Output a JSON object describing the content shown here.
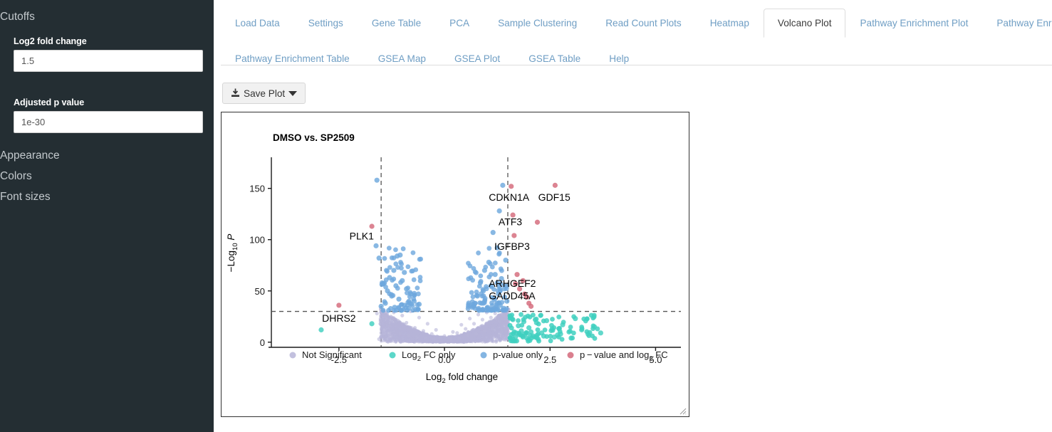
{
  "sidebar": {
    "cutoffs_heading": "Cutoffs",
    "fields": [
      {
        "label": "Log2 fold change",
        "value": "1.5",
        "placeholder": ""
      },
      {
        "label": "Adjusted p value",
        "value": "1e-30",
        "placeholder": ""
      }
    ],
    "collapsibles": [
      {
        "label": "Appearance"
      },
      {
        "label": "Colors"
      },
      {
        "label": "Font sizes"
      }
    ]
  },
  "tabs": {
    "row1": [
      {
        "label": "Load Data",
        "active": false
      },
      {
        "label": "Settings",
        "active": false
      },
      {
        "label": "Gene Table",
        "active": false
      },
      {
        "label": "PCA",
        "active": false
      },
      {
        "label": "Sample Clustering",
        "active": false
      },
      {
        "label": "Read Count Plots",
        "active": false
      },
      {
        "label": "Heatmap",
        "active": false
      },
      {
        "label": "Volcano Plot",
        "active": true
      },
      {
        "label": "Pathway Enrichment Plot",
        "active": false
      },
      {
        "label": "Pathway Enrichment Map",
        "active": false
      }
    ],
    "row2": [
      {
        "label": "Pathway Enrichment Table",
        "active": false
      },
      {
        "label": "GSEA Map",
        "active": false
      },
      {
        "label": "GSEA Plot",
        "active": false
      },
      {
        "label": "GSEA Table",
        "active": false
      },
      {
        "label": "Help",
        "active": false
      }
    ]
  },
  "toolbar": {
    "save_plot_label": "Save Plot",
    "save_icon": "download-icon",
    "caret_icon": "caret-down-icon"
  },
  "colors": {
    "sidebar_bg": "#242e33",
    "tab_link": "#6f9ec4",
    "not_significant": "#b7b5d8",
    "log2fc_only": "#3fd0c0",
    "pvalue_only": "#6ea8dd",
    "pvalue_and_log2fc": "#d4697a",
    "threshold_line": "#555555",
    "axis": "#1a1a1a"
  },
  "chart_data": {
    "type": "scatter",
    "title": "DMSO vs. SP2509",
    "xlabel": "Log2 fold change",
    "ylabel": "-Log10 P",
    "xticks": [
      "-2.5",
      "0.0",
      "2.5",
      "5.0"
    ],
    "xtick_values": [
      -2.5,
      0.0,
      2.5,
      5.0
    ],
    "yticks": [
      "0",
      "50",
      "100",
      "150"
    ],
    "ytick_values": [
      0,
      50,
      100,
      150
    ],
    "xlim": [
      -4.1,
      5.6
    ],
    "ylim": [
      -5,
      172
    ],
    "grid": false,
    "legend_position": "bottom",
    "thresholds": {
      "log2fc_cutoff": 1.5,
      "neg_log2fc_cutoff": -1.5,
      "padj_cutoff": "1e-30",
      "neg_log10_padj_cutoff": 30,
      "line_style": "dashed"
    },
    "legend": [
      {
        "label": "Not Significant",
        "color": "#b7b5d8"
      },
      {
        "label": "Log2 FC only",
        "color": "#3fd0c0"
      },
      {
        "label": "p-value only",
        "color": "#6ea8dd"
      },
      {
        "label": "p-value and log2 FC",
        "color": "#d4697a"
      }
    ],
    "annotations": [
      {
        "gene": "PLK1",
        "x": -1.72,
        "y": 113,
        "label_x": -2.25,
        "label_y": 100
      },
      {
        "gene": "DHRS2",
        "x": -2.5,
        "y": 36,
        "label_x": -2.9,
        "label_y": 20
      },
      {
        "gene": "CDKN1A",
        "x": 1.58,
        "y": 152,
        "label_x": 1.05,
        "label_y": 138
      },
      {
        "gene": "GDF15",
        "x": 2.62,
        "y": 153,
        "label_x": 2.22,
        "label_y": 138
      },
      {
        "gene": "ATF3",
        "x": 1.62,
        "y": 124,
        "label_x": 1.28,
        "label_y": 114
      },
      {
        "gene": "IGFBP3",
        "x": 1.65,
        "y": 104,
        "label_x": 1.18,
        "label_y": 90
      },
      {
        "gene": "ARHGEF2",
        "x": 1.72,
        "y": 66,
        "label_x": 1.05,
        "label_y": 54
      },
      {
        "gene": "GADD45A",
        "x": 1.86,
        "y": 60,
        "label_x": 1.05,
        "label_y": 42
      }
    ],
    "series": [
      {
        "name": "p-value and log2 FC",
        "color": "#d4697a",
        "points": [
          [
            -2.5,
            36
          ],
          [
            -1.72,
            113
          ],
          [
            1.58,
            152
          ],
          [
            2.62,
            153
          ],
          [
            1.62,
            124
          ],
          [
            2.2,
            117
          ],
          [
            1.65,
            104
          ],
          [
            1.72,
            66
          ],
          [
            1.86,
            60
          ],
          [
            1.9,
            47
          ],
          [
            1.78,
            52
          ],
          [
            2.0,
            38
          ],
          [
            1.95,
            44
          ],
          [
            1.68,
            57
          ],
          [
            2.05,
            35
          ]
        ]
      },
      {
        "name": "p-value only",
        "color": "#6ea8dd",
        "points": [
          [
            -1.6,
            158
          ],
          [
            -1.62,
            94
          ],
          [
            -1.55,
            82
          ],
          [
            -1.05,
            85
          ],
          [
            -1.12,
            84
          ],
          [
            -1.3,
            63
          ],
          [
            -1.2,
            70
          ],
          [
            -1.45,
            57
          ],
          [
            -0.95,
            68
          ],
          [
            -1.0,
            60
          ],
          [
            -1.15,
            55
          ],
          [
            -0.9,
            52
          ],
          [
            -1.35,
            50
          ],
          [
            -0.8,
            47
          ],
          [
            -1.25,
            45
          ],
          [
            -1.08,
            42
          ],
          [
            -0.72,
            40
          ],
          [
            -1.4,
            38
          ],
          [
            -0.95,
            36
          ],
          [
            -1.18,
            34
          ],
          [
            -0.6,
            37
          ],
          [
            -0.85,
            33
          ],
          [
            -1.5,
            35
          ],
          [
            -0.68,
            32
          ],
          [
            -1.02,
            31
          ],
          [
            1.38,
            153
          ],
          [
            1.3,
            128
          ],
          [
            1.15,
            107
          ],
          [
            1.25,
            92
          ],
          [
            1.05,
            78
          ],
          [
            1.45,
            80
          ],
          [
            0.95,
            70
          ],
          [
            1.2,
            66
          ],
          [
            1.35,
            62
          ],
          [
            0.85,
            58
          ],
          [
            1.1,
            55
          ],
          [
            1.42,
            52
          ],
          [
            0.92,
            50
          ],
          [
            1.28,
            47
          ],
          [
            0.78,
            45
          ],
          [
            1.18,
            43
          ],
          [
            1.48,
            40
          ],
          [
            0.88,
            38
          ],
          [
            1.32,
            36
          ],
          [
            0.7,
            35
          ],
          [
            1.02,
            34
          ],
          [
            1.22,
            32
          ],
          [
            0.82,
            31
          ],
          [
            1.4,
            33
          ]
        ]
      },
      {
        "name": "Log2 FC only",
        "color": "#3fd0c0",
        "points": [
          [
            -2.92,
            12
          ],
          [
            -1.72,
            18
          ],
          [
            1.62,
            22
          ],
          [
            1.75,
            16
          ],
          [
            1.82,
            11
          ],
          [
            1.9,
            8
          ],
          [
            2.0,
            14
          ],
          [
            2.1,
            6
          ],
          [
            2.18,
            19
          ],
          [
            2.3,
            9
          ],
          [
            2.42,
            21
          ],
          [
            2.55,
            13
          ],
          [
            2.68,
            7
          ],
          [
            2.8,
            17
          ],
          [
            2.95,
            10
          ],
          [
            3.1,
            23
          ],
          [
            3.25,
            12
          ],
          [
            3.4,
            8
          ],
          [
            3.55,
            15
          ],
          [
            3.7,
            9
          ],
          [
            1.68,
            5
          ],
          [
            1.95,
            4
          ],
          [
            2.22,
            3
          ],
          [
            2.6,
            5
          ],
          [
            3.0,
            4
          ],
          [
            1.7,
            9
          ],
          [
            1.88,
            20
          ],
          [
            2.05,
            10
          ],
          [
            2.35,
            6
          ],
          [
            2.75,
            8
          ]
        ]
      },
      {
        "name": "Not Significant",
        "color": "#b7b5d8",
        "points": [
          [
            -1.6,
            28
          ],
          [
            -1.4,
            25
          ],
          [
            -1.2,
            29
          ],
          [
            -1.0,
            26
          ],
          [
            -0.8,
            30
          ],
          [
            -0.6,
            24
          ],
          [
            -0.4,
            18
          ],
          [
            -0.2,
            12
          ],
          [
            0.0,
            6
          ],
          [
            0.2,
            10
          ],
          [
            0.4,
            17
          ],
          [
            0.6,
            23
          ],
          [
            0.8,
            27
          ],
          [
            1.0,
            29
          ],
          [
            1.2,
            28
          ],
          [
            1.4,
            26
          ],
          [
            -1.5,
            20
          ],
          [
            -1.3,
            16
          ],
          [
            -1.1,
            21
          ],
          [
            -0.9,
            19
          ],
          [
            -0.7,
            14
          ],
          [
            -0.5,
            11
          ],
          [
            -0.3,
            8
          ],
          [
            -0.1,
            4
          ],
          [
            0.1,
            5
          ],
          [
            0.3,
            9
          ],
          [
            0.5,
            13
          ],
          [
            0.7,
            18
          ],
          [
            0.9,
            22
          ],
          [
            1.1,
            24
          ],
          [
            1.3,
            20
          ],
          [
            -1.45,
            8
          ],
          [
            -1.25,
            6
          ],
          [
            -1.05,
            9
          ],
          [
            -0.85,
            7
          ],
          [
            -0.65,
            5
          ],
          [
            -0.45,
            4
          ],
          [
            -0.25,
            3
          ],
          [
            0.15,
            3
          ],
          [
            0.35,
            4
          ],
          [
            0.55,
            6
          ],
          [
            0.75,
            8
          ],
          [
            0.95,
            11
          ],
          [
            1.15,
            13
          ],
          [
            1.35,
            10
          ],
          [
            -1.55,
            3
          ],
          [
            1.45,
            5
          ]
        ]
      }
    ]
  }
}
